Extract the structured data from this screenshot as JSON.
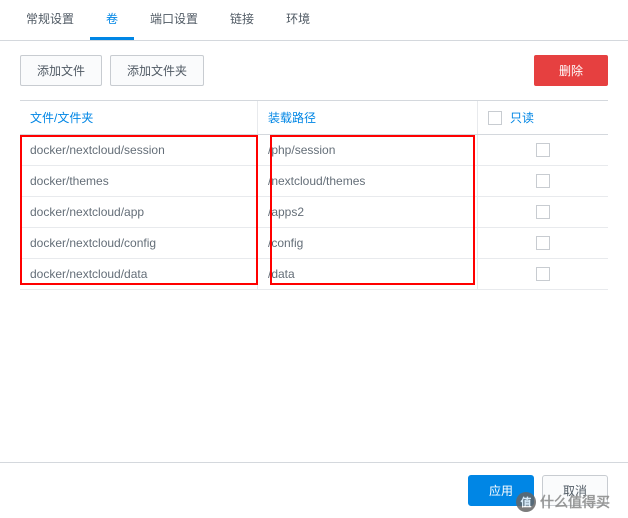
{
  "tabs": [
    {
      "label": "常规设置",
      "active": false
    },
    {
      "label": "卷",
      "active": true
    },
    {
      "label": "端口设置",
      "active": false
    },
    {
      "label": "链接",
      "active": false
    },
    {
      "label": "环境",
      "active": false
    }
  ],
  "toolbar": {
    "add_file": "添加文件",
    "add_folder": "添加文件夹",
    "delete": "删除"
  },
  "columns": {
    "file": "文件/文件夹",
    "mount": "装载路径",
    "readonly": "只读"
  },
  "rows": [
    {
      "file": "docker/nextcloud/session",
      "mount": "/php/session"
    },
    {
      "file": "docker/themes",
      "mount": "/nextcloud/themes"
    },
    {
      "file": "docker/nextcloud/app",
      "mount": "/apps2"
    },
    {
      "file": "docker/nextcloud/config",
      "mount": "/config"
    },
    {
      "file": "docker/nextcloud/data",
      "mount": "/data"
    }
  ],
  "footer": {
    "apply": "应用",
    "cancel": "取消"
  },
  "watermark": {
    "badge": "值",
    "text": "什么值得买"
  }
}
